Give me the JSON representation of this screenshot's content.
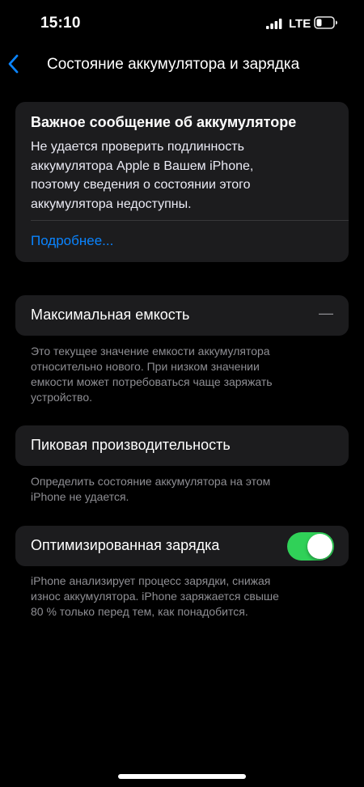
{
  "status_bar": {
    "time": "15:10",
    "network": "LTE"
  },
  "nav": {
    "back_icon": "chevron-left-icon",
    "title": "Состояние аккумулятора и зарядка"
  },
  "alert": {
    "title": "Важное сообщение об аккумуляторе",
    "body_lines": [
      "Не удается проверить подлинность",
      "аккумулятора Apple в Вашем iPhone,",
      "поэтому сведения о состоянии этого",
      "аккумулятора недоступны."
    ],
    "link": "Подробнее..."
  },
  "max_capacity": {
    "label": "Максимальная емкость",
    "value": "—",
    "footnote_lines": [
      "Это текущее значение емкости аккумулятора",
      "относительно нового. При низком значении",
      "емкости может потребоваться чаще заряжать",
      "устройство."
    ]
  },
  "peak_performance": {
    "label": "Пиковая производительность",
    "footnote_lines": [
      "Определить состояние аккумулятора на этом",
      "iPhone не удается."
    ]
  },
  "optimized_charging": {
    "label": "Оптимизированная зарядка",
    "enabled": true,
    "toggle_color": "#30d158",
    "footnote_lines": [
      "iPhone анализирует процесс зарядки, снижая",
      "износ аккумулятора. iPhone заряжается свыше",
      "80 % только перед тем, как понадобится."
    ]
  },
  "colors": {
    "background": "#000000",
    "card": "#1c1c1e",
    "accent": "#0a84ff",
    "secondary_text": "#8e8e93"
  }
}
